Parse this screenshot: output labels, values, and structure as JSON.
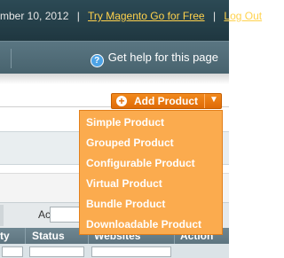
{
  "header": {
    "date_text": "mber 10, 2012",
    "separator": "|",
    "try_link": "Try Magento Go for Free",
    "logout_link": "Log Out"
  },
  "navbar": {
    "help_text": "Get help for this page",
    "help_icon": "help-icon"
  },
  "add_product": {
    "label": "Add Product",
    "plus_icon": "plus-circle-icon",
    "caret": "▼",
    "menu": [
      "Simple Product",
      "Grouped Product",
      "Configurable Product",
      "Virtual Product",
      "Bundle Product",
      "Downloadable Product"
    ]
  },
  "toolbar": {
    "actions_label": "Actions"
  },
  "grid": {
    "columns": [
      "ty",
      "Status",
      "Websites",
      "Action"
    ]
  },
  "colors": {
    "accent_orange": "#e97a12",
    "menu_bg": "#fbab4e",
    "header_dark": "#24414b",
    "link_yellow": "#ffd24d"
  }
}
